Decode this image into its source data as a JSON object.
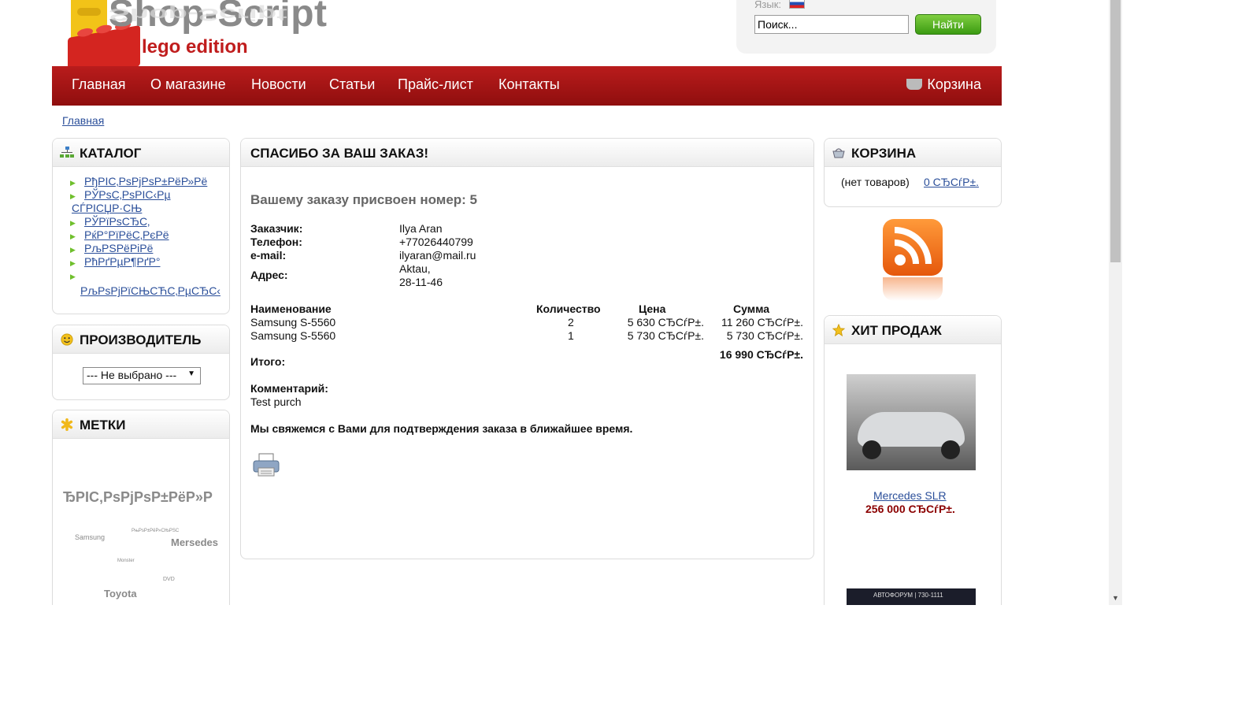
{
  "header": {
    "logo_title": "Shop-Script",
    "logo_subtitle": "lego edition",
    "lang_label": "Язык:",
    "search_placeholder": "Поиск...",
    "search_button": "Найти"
  },
  "nav": {
    "items": [
      "Главная",
      "О магазине",
      "Новости",
      "Статьи",
      "Прайс-лист",
      "Контакты"
    ],
    "cart": "Корзина"
  },
  "breadcrumb": "Главная",
  "catalog": {
    "title": "КАТАЛОГ",
    "items": [
      "РђРІС‚РѕРјРѕР±РёР»Рё",
      "РЎРѕС‚РѕРІС‹Рµ",
      "СЃРІСЏР·СЊ",
      "РЎРїРѕСЂС‚",
      "РќР°РїРёС‚РєРё",
      "РљРЅРёРіРё",
      "РћРґРµР¶РґР°",
      "РљРѕРјРїСЊСЋС‚РµСЂС‹"
    ]
  },
  "maker": {
    "title": "ПРОИЗВОДИТЕЛЬ",
    "select_value": "--- Не выбрано ---"
  },
  "tags": {
    "title": "МЕТКИ",
    "items": [
      "ЂРІС‚РѕРјРѕР±РёР»Р",
      "Samsung",
      "РњРѕР±РёР»СЊРЅС",
      "Mersedes",
      "Monster",
      "DVD",
      "Toyota"
    ]
  },
  "order": {
    "title": "СПАСИБО ЗА ВАШ ЗАКАЗ!",
    "number_line": "Вашему заказу присвоен номер: 5",
    "customer_label": "Заказчик:",
    "customer_value": "Ilya Aran",
    "phone_label": "Телефон:",
    "phone_value": "+77026440799",
    "email_label": "e-mail:",
    "email_value": "ilyaran@mail.ru",
    "address_label": "Адрес:",
    "address_line1": "Aktau,",
    "address_line2": "28-11-46",
    "columns": [
      "Наименование",
      "Количество",
      "Цена",
      "Сумма"
    ],
    "rows": [
      {
        "name": "Samsung S-5560",
        "qty": "2",
        "price": "5 630 СЂСѓР±.",
        "sum": "11 260 СЂСѓР±."
      },
      {
        "name": "Samsung S-5560",
        "qty": "1",
        "price": "5 730 СЂСѓР±.",
        "sum": "5 730 СЂСѓР±."
      }
    ],
    "total_label": "Итого:",
    "total_value": "16 990 СЂСѓР±.",
    "comment_label": "Комментарий:",
    "comment_value": "Test purch",
    "confirm_text": "Мы свяжемся с Вами для подтверждения заказа в ближайшее время."
  },
  "cart_box": {
    "title": "КОРЗИНА",
    "empty_text": "(нет товаров)",
    "total_link": "0 СЂСѓР±."
  },
  "hits": {
    "title": "ХИТ ПРОДАЖ",
    "product_name": "Mercedes SLR",
    "product_price": "256 000 СЂСѓР±.",
    "second_product_caption": "АВТОФОРУМ | 730-1111"
  },
  "colors": {
    "nav_red": "#a01414",
    "price_red": "#8b0000",
    "link_blue": "#2b4f9a",
    "search_green": "#4cae1d"
  },
  "icons": [
    "sitemap-icon",
    "smiley-icon",
    "asterisk-icon",
    "basket-icon",
    "star-icon",
    "rss-icon",
    "printer-icon",
    "flag-ru-icon"
  ]
}
